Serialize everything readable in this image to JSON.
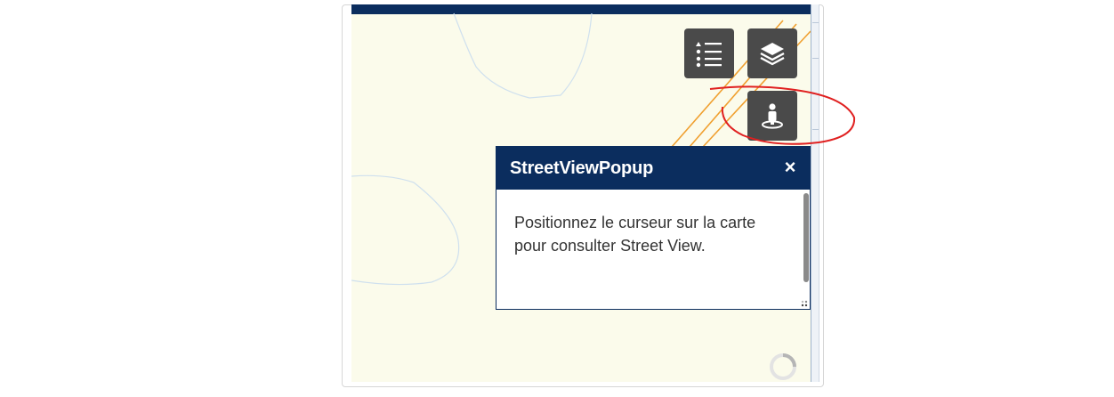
{
  "popup": {
    "title": "StreetViewPopup",
    "close_symbol": "×",
    "message": "Positionnez le curseur sur la carte pour consulter Street View."
  },
  "toolbar": {
    "buttons": [
      {
        "icon": "legend-list-icon"
      },
      {
        "icon": "layers-icon"
      },
      {
        "icon": "street-view-pegman-icon"
      }
    ]
  },
  "colors": {
    "header_navy": "#0b2d5e",
    "button_gray": "#4a4a4a",
    "map_background": "#fbfbeb",
    "road_orange": "#f0a030",
    "annotation_red": "#e02020"
  },
  "status": {
    "loading_indicator": "spinner-icon"
  }
}
